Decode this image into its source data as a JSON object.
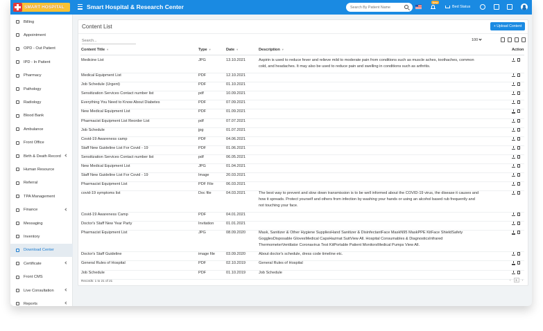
{
  "header": {
    "logo_text": "SMART HOSPITAL",
    "app_title": "Smart Hospital & Research Center",
    "search_placeholder": "Search By Patient Name",
    "notification_badge": "New",
    "bed_status": "Bed Status",
    "icons": [
      "menu-icon",
      "search-icon",
      "flag-icon",
      "bell-icon",
      "bed-icon",
      "whatsapp-icon",
      "calendar-icon",
      "task-icon",
      "avatar"
    ]
  },
  "sidebar": {
    "items": [
      {
        "label": "Billing",
        "icon": "billing-icon",
        "expand": false
      },
      {
        "label": "Appointment",
        "icon": "appointment-icon",
        "expand": false
      },
      {
        "label": "OPD - Out Patient",
        "icon": "opd-icon",
        "expand": false
      },
      {
        "label": "IPD - In Patient",
        "icon": "ipd-icon",
        "expand": false
      },
      {
        "label": "Pharmacy",
        "icon": "pharmacy-icon",
        "expand": false
      },
      {
        "label": "Pathology",
        "icon": "pathology-icon",
        "expand": false
      },
      {
        "label": "Radiology",
        "icon": "radiology-icon",
        "expand": false
      },
      {
        "label": "Blood Bank",
        "icon": "blood-bank-icon",
        "expand": false
      },
      {
        "label": "Ambulance",
        "icon": "ambulance-icon",
        "expand": false
      },
      {
        "label": "Front Office",
        "icon": "front-office-icon",
        "expand": false
      },
      {
        "label": "Birth & Death Record",
        "icon": "birth-death-icon",
        "expand": true
      },
      {
        "label": "Human Resource",
        "icon": "human-resource-icon",
        "expand": false
      },
      {
        "label": "Referral",
        "icon": "referral-icon",
        "expand": false
      },
      {
        "label": "TPA Management",
        "icon": "tpa-icon",
        "expand": false
      },
      {
        "label": "Finance",
        "icon": "finance-icon",
        "expand": true
      },
      {
        "label": "Messaging",
        "icon": "messaging-icon",
        "expand": false
      },
      {
        "label": "Inventory",
        "icon": "inventory-icon",
        "expand": false
      },
      {
        "label": "Download Center",
        "icon": "download-icon",
        "expand": false,
        "active": true
      },
      {
        "label": "Certificate",
        "icon": "certificate-icon",
        "expand": true
      },
      {
        "label": "Front CMS",
        "icon": "cms-icon",
        "expand": false
      },
      {
        "label": "Live Consultation",
        "icon": "live-consultation-icon",
        "expand": true
      },
      {
        "label": "Reports",
        "icon": "reports-icon",
        "expand": true
      }
    ]
  },
  "content": {
    "title": "Content List",
    "upload_button": "+ Upload Content",
    "search_placeholder": "Search...",
    "page_size": "100",
    "columns": [
      "Content Title",
      "Type",
      "Date",
      "Description",
      "Action"
    ],
    "rows": [
      {
        "title": "Medicine List",
        "type": "JPG",
        "date": "13.10.2021",
        "desc": "Aspirin is used to reduce fever and relieve mild to moderate pain from conditions such as muscle aches, toothaches, common cold, and headaches. It may also be used to reduce pain and swelling in conditions such as arthritis.",
        "lines": 2
      },
      {
        "title": "Medical Equipment List",
        "type": "PDF",
        "date": "12.10.2021",
        "desc": "",
        "lines": 1
      },
      {
        "title": "Job Schedule (Urgent)",
        "type": "PDF",
        "date": "01.10.2021",
        "desc": "",
        "lines": 1
      },
      {
        "title": "Sensitization Services Contact number list",
        "type": "pdf",
        "date": "10.09.2021",
        "desc": "",
        "lines": 1
      },
      {
        "title": "Everything You Need to Know About Diabetes",
        "type": "PDF",
        "date": "07.09.2021",
        "desc": "",
        "lines": 1
      },
      {
        "title": "New Medical Equipment List",
        "type": "PDF",
        "date": "01.09.2021",
        "desc": "",
        "lines": 1
      },
      {
        "title": "Pharmacist Equipment List Reorder List",
        "type": "pdf",
        "date": "07.07.2021",
        "desc": "",
        "lines": 1
      },
      {
        "title": "Job Schedule",
        "type": "jpg",
        "date": "01.07.2021",
        "desc": "",
        "lines": 1
      },
      {
        "title": "Covid-19 Awareness camp",
        "type": "PDF",
        "date": "04.06.2021",
        "desc": "",
        "lines": 1
      },
      {
        "title": "Staff New Guideline List For Covid - 19",
        "type": "PDF",
        "date": "01.06.2021",
        "desc": "",
        "lines": 1
      },
      {
        "title": "Sensitization Services Contact number list",
        "type": "pdf",
        "date": "06.05.2021",
        "desc": "",
        "lines": 1
      },
      {
        "title": "New Medical Equipment List",
        "type": "JPG",
        "date": "01.04.2021",
        "desc": "",
        "lines": 1
      },
      {
        "title": "Staff New Guideline List For Covid - 19",
        "type": "Image",
        "date": "20.03.2021",
        "desc": "",
        "lines": 1
      },
      {
        "title": "Pharmacist Equipment List",
        "type": "PDF File",
        "date": "06.03.2021",
        "desc": "",
        "lines": 1
      },
      {
        "title": "covid-19 symptoms list",
        "type": "Doc file",
        "date": "04.03.2021",
        "desc": "The best way to prevent and slow down transmission is to be well informed about the COVID-19 virus, the disease it causes and how it spreads. Protect yourself and others from infection by washing your hands or using an alcohol based rub frequently and not touching your face.",
        "lines": 3
      },
      {
        "title": "Covid-19 Awareness Camp",
        "type": "PDF",
        "date": "04.01.2021",
        "desc": "",
        "lines": 1
      },
      {
        "title": "Doctor's Staff New Year Party",
        "type": "Invitation",
        "date": "01.01.2021",
        "desc": "",
        "lines": 1
      },
      {
        "title": "Pharmacist Equipment List",
        "type": "JPG",
        "date": "08.09.2020",
        "desc": "Mask, Sanitizer & Other Hygiene SuppliesHand Sanitizer & DisinfectantFace MaskN95 MaskPPE KitFace ShieldSafety GogglesDisposable GlovesMedical CapsHazmat SuitView All. Hospital Consumables & DiagnosticsInfrared ThermometerVentilator Coronavirus Test KitPortable Patient MonitorsMedical Pumps View All.",
        "lines": 3
      },
      {
        "title": "Doctor's Staff Guideline",
        "type": "image file",
        "date": "03.09.2020",
        "desc": "About doctor's schedule, dress code timeline etc.",
        "lines": 1
      },
      {
        "title": "General Rules of Hospital",
        "type": "PDF",
        "date": "02.10.2019",
        "desc": "General Rules of Hospital",
        "lines": 1
      },
      {
        "title": "Job Schedule",
        "type": "PDF",
        "date": "01.10.2019",
        "desc": "Job Schedule",
        "lines": 1
      }
    ],
    "records_text": "Records: 1 to 21 of 21",
    "pager": {
      "prev": "‹",
      "page": "1",
      "next": "›"
    }
  },
  "colors": {
    "primary": "#1a8ae2",
    "logo": "#f8c234",
    "active_bg": "#e4ebf1"
  }
}
